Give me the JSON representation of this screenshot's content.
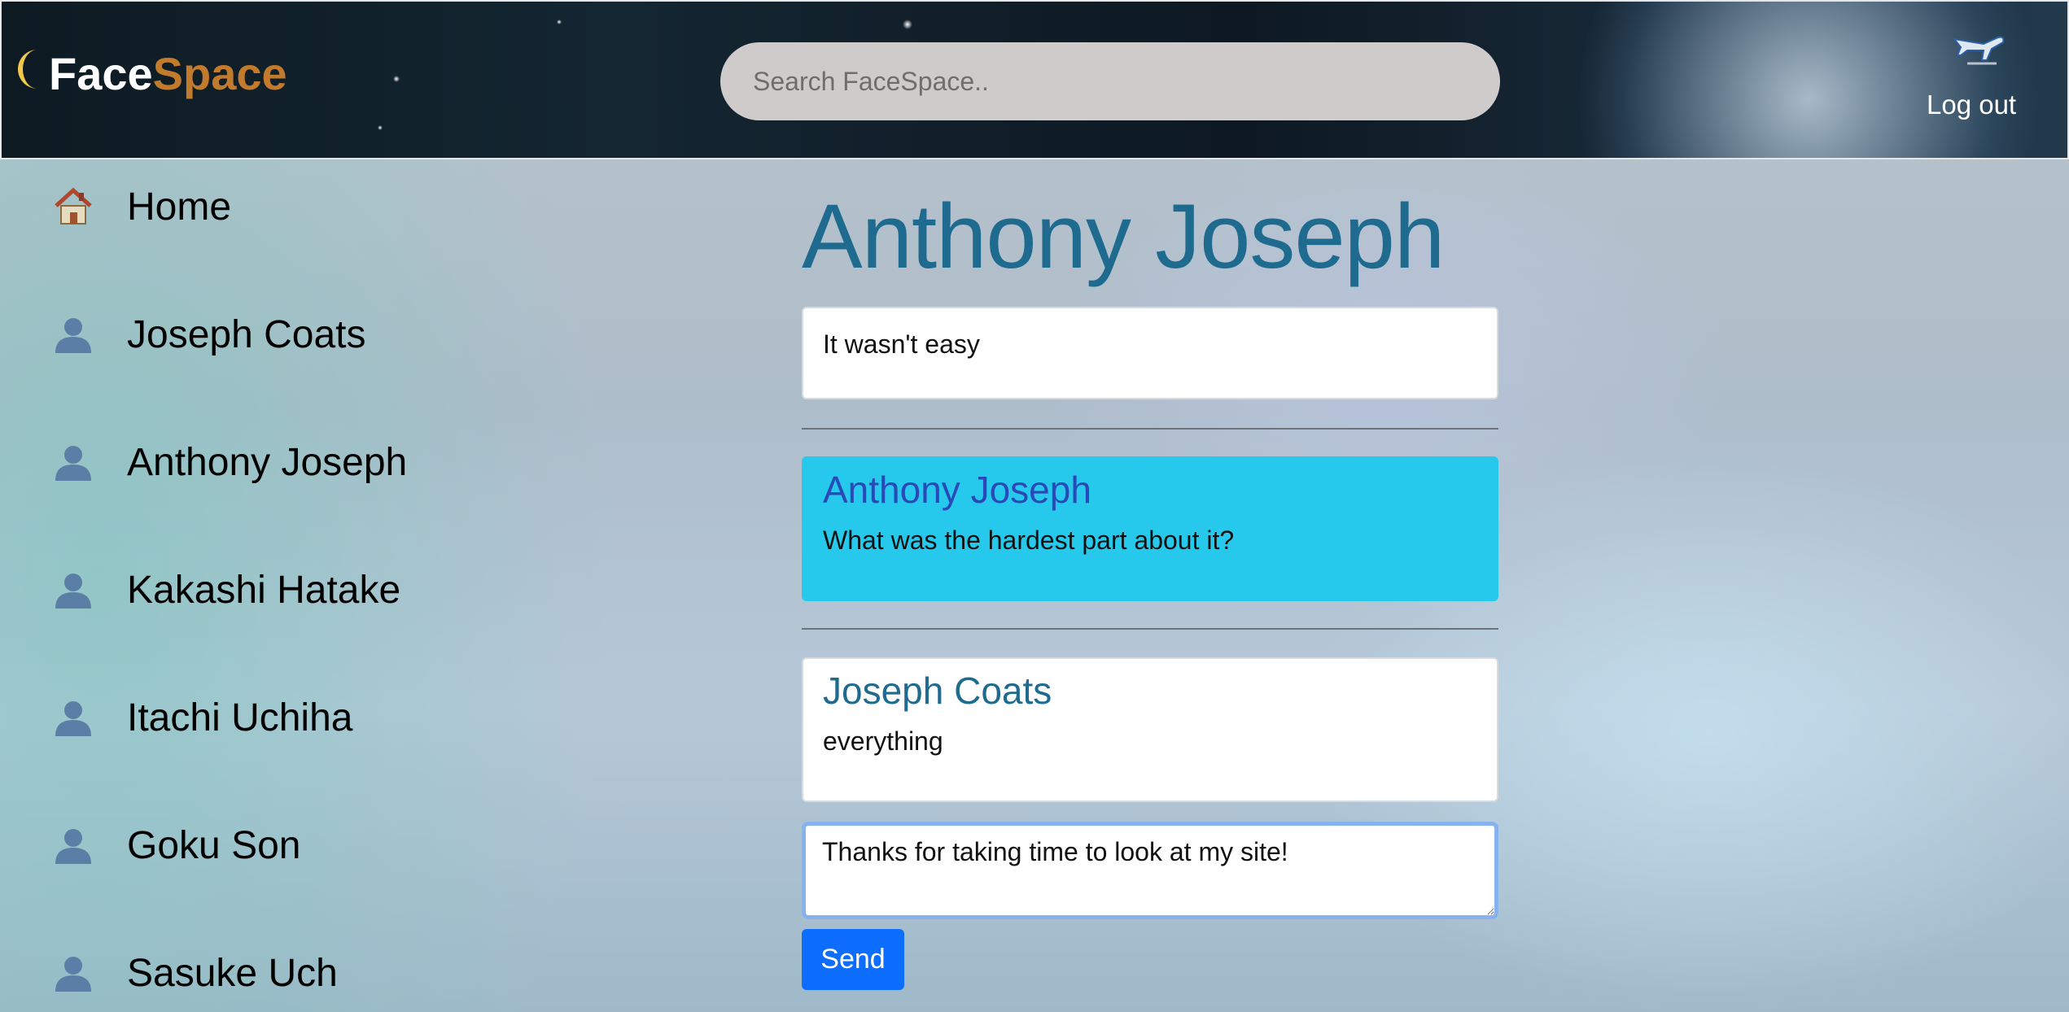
{
  "header": {
    "logo_part1": "Face",
    "logo_part2": "Space",
    "logo_icon": "crescent-moon-icon",
    "search_placeholder": "Search FaceSpace..",
    "logout_label": "Log out",
    "logout_icon": "airplane-icon"
  },
  "sidebar": {
    "items": [
      {
        "label": "Home",
        "icon": "house-icon"
      },
      {
        "label": "Joseph Coats",
        "icon": "user-icon"
      },
      {
        "label": "Anthony Joseph",
        "icon": "user-icon"
      },
      {
        "label": "Kakashi Hatake",
        "icon": "user-icon"
      },
      {
        "label": "Itachi Uchiha",
        "icon": "user-icon"
      },
      {
        "label": "Goku Son",
        "icon": "user-icon"
      },
      {
        "label": "Sasuke Uch",
        "icon": "user-icon"
      }
    ]
  },
  "main": {
    "title": "Anthony Joseph",
    "messages": [
      {
        "author": "",
        "text": "It wasn't easy"
      },
      {
        "author": "Anthony Joseph",
        "text": "What was the hardest part about it?"
      },
      {
        "author": "Joseph Coats",
        "text": "everything"
      }
    ],
    "reply_value": "Thanks for taking time to look at my site!",
    "send_label": "Send"
  },
  "colors": {
    "accent": "#0d6efd",
    "title": "#1f6b8f",
    "highlight_card": "#26c9ec",
    "logo_space": "#c27a2c"
  }
}
